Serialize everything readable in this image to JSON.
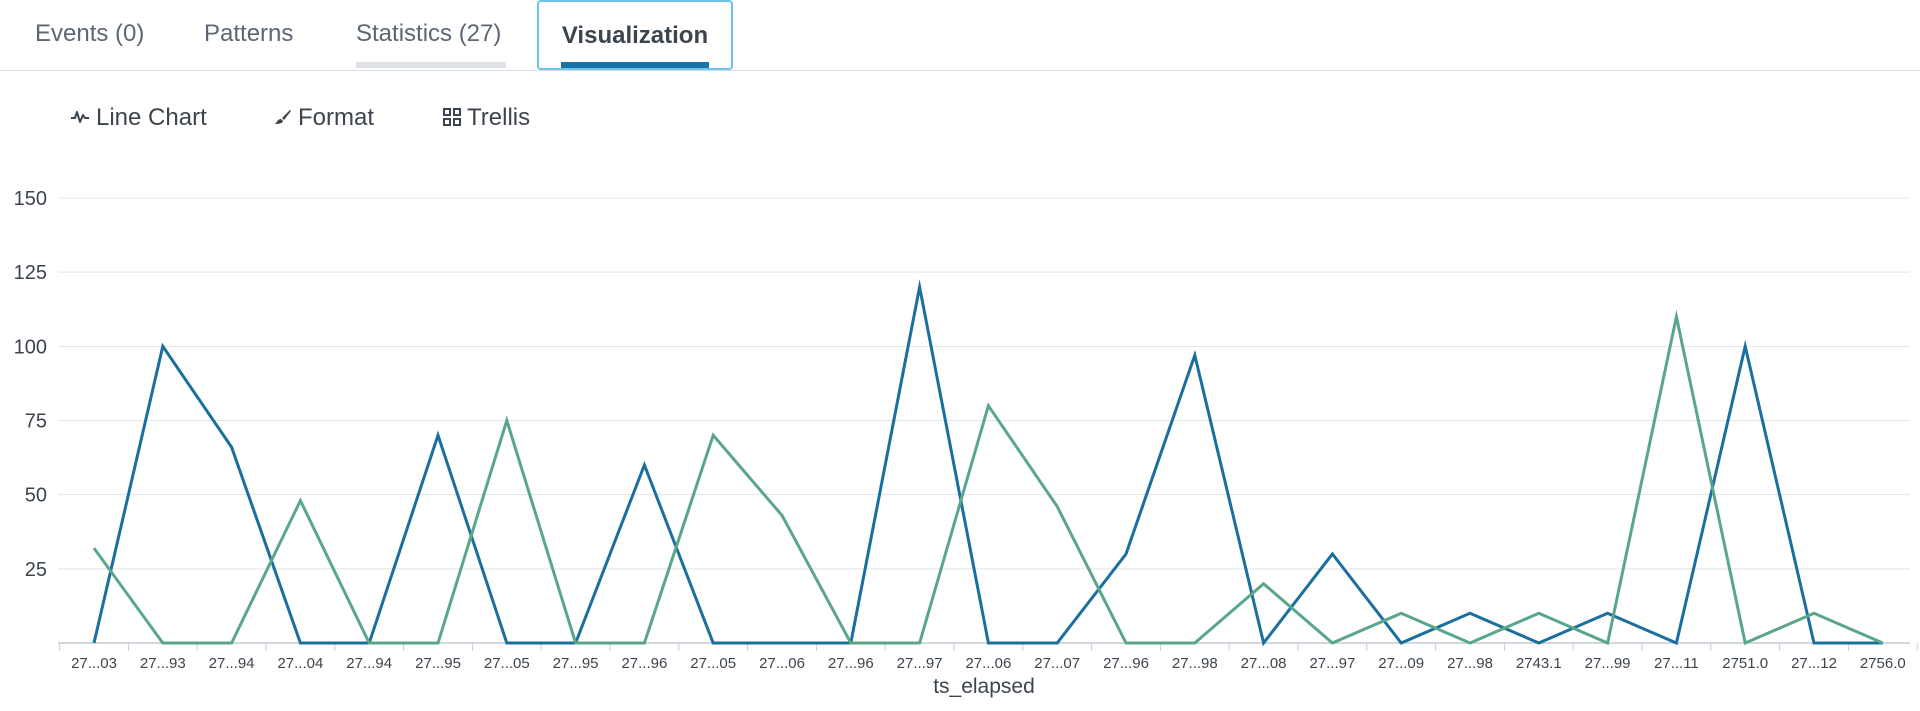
{
  "tabs": [
    {
      "label": "Events (0)"
    },
    {
      "label": "Patterns"
    },
    {
      "label": "Statistics (27)"
    },
    {
      "label": "Visualization"
    }
  ],
  "toolbar": {
    "line_chart": "Line Chart",
    "format": "Format",
    "trellis": "Trellis"
  },
  "chart_data": {
    "type": "line",
    "xlabel": "ts_elapsed",
    "ylabel": "",
    "ylim": [
      0,
      150
    ],
    "yticks": [
      25,
      50,
      75,
      100,
      125,
      150
    ],
    "grid": true,
    "categories": [
      "27...03",
      "27...93",
      "27...94",
      "27...04",
      "27...94",
      "27...95",
      "27...05",
      "27...95",
      "27...96",
      "27...05",
      "27...06",
      "27...96",
      "27...97",
      "27...06",
      "27...07",
      "27...96",
      "27...98",
      "27...08",
      "27...97",
      "27...09",
      "27...98",
      "2743.1",
      "27...99",
      "27...11",
      "2751.0",
      "27...12",
      "2756.0"
    ],
    "series": [
      {
        "color": "#1a6f9e",
        "values": [
          0,
          100,
          66,
          0,
          0,
          70,
          0,
          0,
          60,
          0,
          0,
          0,
          120,
          0,
          0,
          30,
          97,
          0,
          30,
          0,
          10,
          0,
          10,
          0,
          100,
          0,
          0
        ]
      },
      {
        "color": "#5aa68a",
        "values": [
          32,
          0,
          0,
          48,
          0,
          0,
          75,
          0,
          0,
          70,
          43,
          0,
          0,
          80,
          46,
          0,
          0,
          20,
          0,
          10,
          0,
          10,
          0,
          110,
          0,
          10,
          0
        ]
      }
    ]
  }
}
